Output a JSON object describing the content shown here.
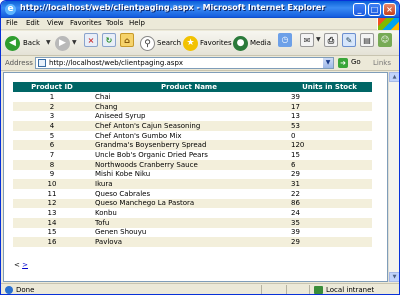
{
  "window": {
    "title": "http://localhost/web/clientpaging.aspx - Microsoft Internet Explorer",
    "minimize": "_",
    "maximize": "□",
    "close": "×"
  },
  "menu": [
    "File",
    "Edit",
    "View",
    "Favorites",
    "Tools",
    "Help"
  ],
  "toolbar": {
    "back": "Back",
    "search": "Search",
    "favorites": "Favorites",
    "media": "Media"
  },
  "address": {
    "label": "Address",
    "url": "http://localhost/web/clientpaging.aspx",
    "go": "Go",
    "links": "Links"
  },
  "table": {
    "headers": [
      "Product ID",
      "Product Name",
      "Units in Stock"
    ],
    "rows": [
      [
        "1",
        "Chai",
        "39"
      ],
      [
        "2",
        "Chang",
        "17"
      ],
      [
        "3",
        "Aniseed Syrup",
        "13"
      ],
      [
        "4",
        "Chef Anton's Cajun Seasoning",
        "53"
      ],
      [
        "5",
        "Chef Anton's Gumbo Mix",
        "0"
      ],
      [
        "6",
        "Grandma's Boysenberry Spread",
        "120"
      ],
      [
        "7",
        "Uncle Bob's Organic Dried Pears",
        "15"
      ],
      [
        "8",
        "Northwoods Cranberry Sauce",
        "6"
      ],
      [
        "9",
        "Mishi Kobe Niku",
        "29"
      ],
      [
        "10",
        "Ikura",
        "31"
      ],
      [
        "11",
        "Queso Cabrales",
        "22"
      ],
      [
        "12",
        "Queso Manchego La Pastora",
        "86"
      ],
      [
        "13",
        "Konbu",
        "24"
      ],
      [
        "14",
        "Tofu",
        "35"
      ],
      [
        "15",
        "Genen Shouyu",
        "39"
      ],
      [
        "16",
        "Pavlova",
        "29"
      ]
    ]
  },
  "pager": {
    "prev": "<",
    "next": ">"
  },
  "status": {
    "text": "Done",
    "zone": "Local intranet"
  },
  "colors": {
    "header_bg": "#006666",
    "alt_row_bg": "#f3efdb",
    "titlebar": "#0a5fd8"
  }
}
